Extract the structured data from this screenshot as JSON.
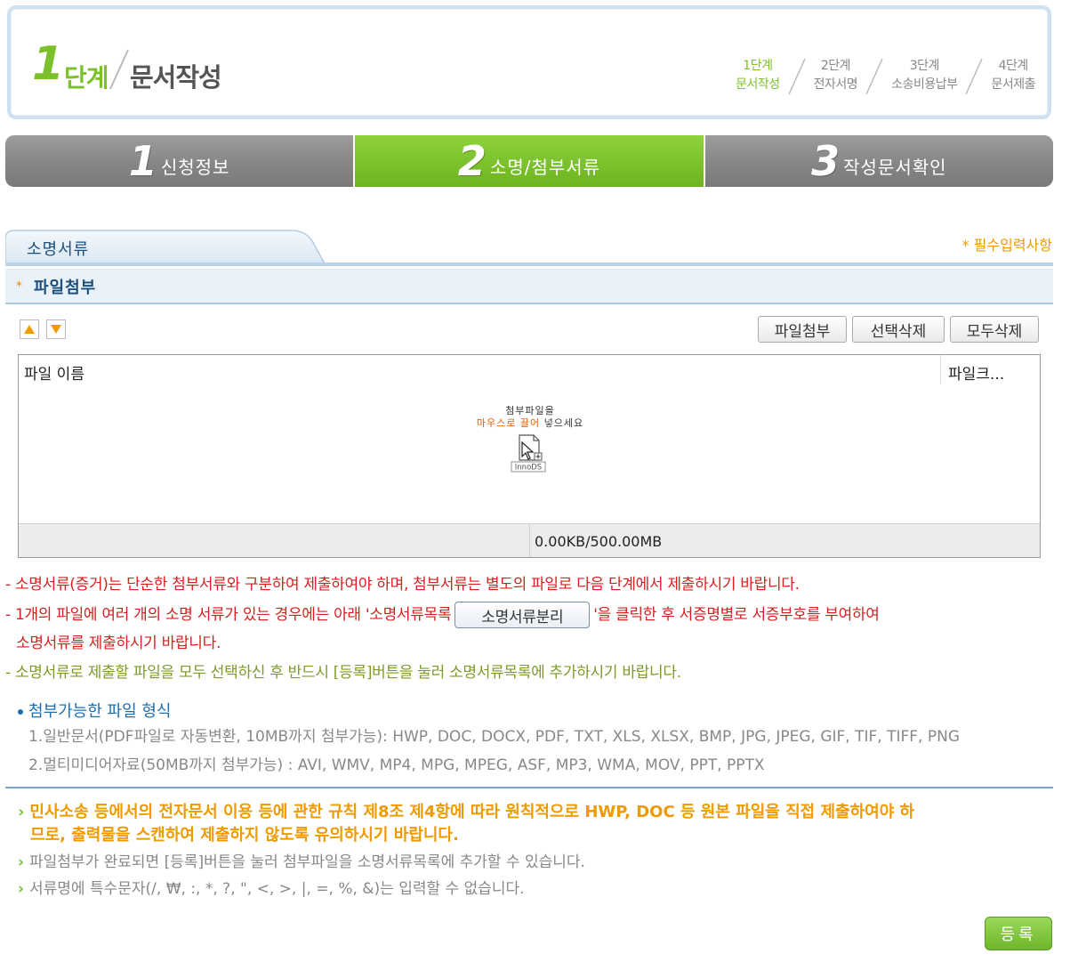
{
  "step_header": {
    "big_number": "1",
    "big_unit": "단계",
    "big_title": "문서작성",
    "steps": [
      {
        "line1": "1단계",
        "line2": "문서작성",
        "active": true
      },
      {
        "line1": "2단계",
        "line2": "전자서명",
        "active": false
      },
      {
        "line1": "3단계",
        "line2": "소송비용납부",
        "active": false
      },
      {
        "line1": "4단계",
        "line2": "문서제출",
        "active": false
      }
    ]
  },
  "tabs": [
    {
      "num": "1",
      "label": "신청정보",
      "active": false
    },
    {
      "num": "2",
      "label": "소명/첨부서류",
      "active": true
    },
    {
      "num": "3",
      "label": "작성문서확인",
      "active": false
    }
  ],
  "section": {
    "title": "소명서류",
    "required_note": "* 필수입력사항",
    "sub_title": "파일첨부",
    "sub_star": "*"
  },
  "toolbar": {
    "attach_label": "파일첨부",
    "delete_selected_label": "선택삭제",
    "delete_all_label": "모두삭제"
  },
  "filelist": {
    "col_name": "파일 이름",
    "col_size": "파일크...",
    "drop_line1": "첨부파일을",
    "drop_line2_orange": "마우스로 끌어",
    "drop_line2_rest": " 넣으세요",
    "drop_brand": "InnoDS",
    "capacity": "0.00KB/500.00MB"
  },
  "notes": {
    "note1": "- 소명서류(증거)는 단순한 첨부서류와 구분하여 제출하여야 하며, 첨부서류는 별도의 파일로 다음 단계에서 제출하시기 바랍니다.",
    "note2_pre": "- 1개의 파일에 여러 개의 소명 서류가 있는 경우에는 아래 '소명서류목록",
    "note2_btn": "소명서류분리",
    "note2_post": "'을 클릭한 후 서증명별로 서증부호를 부여하여",
    "note2_line2": "소명서류를 제출하시기 바랍니다.",
    "note3": "- 소명서류로 제출할 파일을 모두 선택하신 후 반드시 [등록]버튼을 눌러 소명서류목록에 추가하시기 바랍니다."
  },
  "formats": {
    "title": "첨부가능한 파일 형식",
    "line1": "1.일반문서(PDF파일로 자동변환, 10MB까지 첨부가능): HWP, DOC, DOCX, PDF, TXT, XLS, XLSX, BMP, JPG, JPEG, GIF, TIF, TIFF, PNG",
    "line2": "2.멀티미디어자료(50MB까지 첨부가능) : AVI, WMV, MP4, MPG, MPEG, ASF, MP3, WMA, MOV, PPT, PPTX"
  },
  "bullets": {
    "b1_line1": "민사소송 등에서의 전자문서 이용 등에 관한 규칙 제8조 제4항에 따라 원칙적으로 HWP, DOC 등 원본 파일을 직접 제출하여야 하",
    "b1_line2": "므로, 출력물을 스캔하여 제출하지 않도록 유의하시기 바랍니다.",
    "b2": "파일첨부가 완료되면 [등록]버튼을 눌러 첨부파일을 소명서류목록에 추가할 수 있습니다.",
    "b3": "서류명에 특수문자(/, ₩, :, *, ?, \", <, >, |, =, %, &)는 입력할 수 없습니다."
  },
  "register_label": "등록",
  "colors": {
    "accent_green": "#7cc02c",
    "tab_gray": "#8c8c8c",
    "required_orange": "#ee9a00",
    "warning_red": "#d42020",
    "navy": "#1d4f7d"
  }
}
